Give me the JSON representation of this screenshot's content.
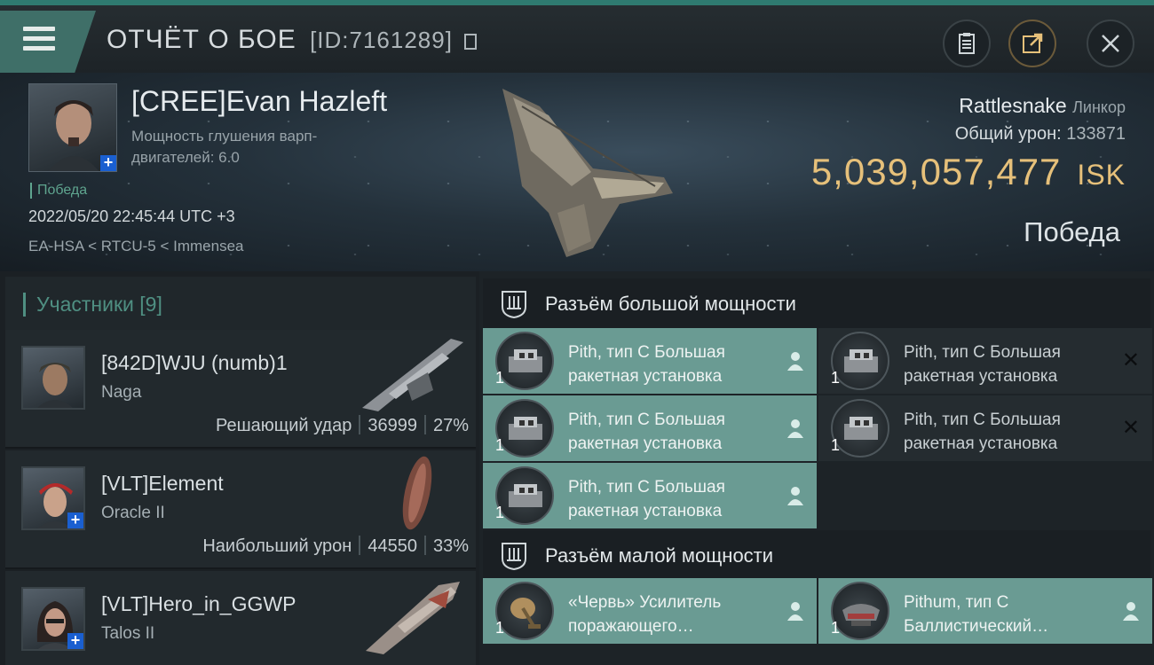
{
  "header": {
    "title": "ОТЧЁТ О БОЕ",
    "report_id": "[ID:7161289]"
  },
  "victim": {
    "name": "[CREE]Evan Hazleft",
    "warp_label": "Мощность глушения варп-двигателей: 6.0",
    "status_tag": "Победа",
    "datetime": "2022/05/20 22:45:44 UTC +3",
    "location": "EA-HSA < RTCU-5 < Immensea",
    "ship": "Rattlesnake",
    "ship_class": "Линкор",
    "damage_label": "Общий урон:",
    "damage_value": "133871",
    "isk_value": "5,039,057,477",
    "isk_unit": "ISK",
    "result": "Победа"
  },
  "participants": {
    "title": "Участники [9]",
    "items": [
      {
        "name": "[842D]WJU (numb)1",
        "ship": "Naga",
        "role": "Решающий удар",
        "damage": "36999",
        "percent": "27%",
        "plus": false
      },
      {
        "name": "[VLT]Element",
        "ship": "Oracle II",
        "role": "Наибольший урон",
        "damage": "44550",
        "percent": "33%",
        "plus": true
      },
      {
        "name": "[VLT]Hero_in_GGWP",
        "ship": "Talos II",
        "role": "",
        "damage": "",
        "percent": "",
        "plus": true
      }
    ]
  },
  "high_slots": {
    "title": "Разъём большой мощности",
    "items": [
      {
        "l1": "Pith, тип C Большая",
        "l2": "ракетная установка",
        "qty": "1",
        "state": "fitted"
      },
      {
        "l1": "Pith, тип C Большая",
        "l2": "ракетная установка",
        "qty": "1",
        "state": "destroyed"
      },
      {
        "l1": "Pith, тип C Большая",
        "l2": "ракетная установка",
        "qty": "1",
        "state": "fitted"
      },
      {
        "l1": "Pith, тип C Большая",
        "l2": "ракетная установка",
        "qty": "1",
        "state": "destroyed"
      },
      {
        "l1": "Pith, тип C Большая",
        "l2": "ракетная установка",
        "qty": "1",
        "state": "fitted"
      }
    ]
  },
  "low_slots": {
    "title": "Разъём малой мощности",
    "items": [
      {
        "l1": "«Червь» Усилитель",
        "l2": "поражающего…",
        "qty": "1",
        "state": "fitted"
      },
      {
        "l1": "Pithum, тип C",
        "l2": "Баллистический…",
        "qty": "1",
        "state": "fitted"
      }
    ]
  },
  "colors": {
    "accent": "#2f7a70",
    "isk": "#e6c07a",
    "module_active": "#6a9b93",
    "status_green": "#5fa58f"
  }
}
